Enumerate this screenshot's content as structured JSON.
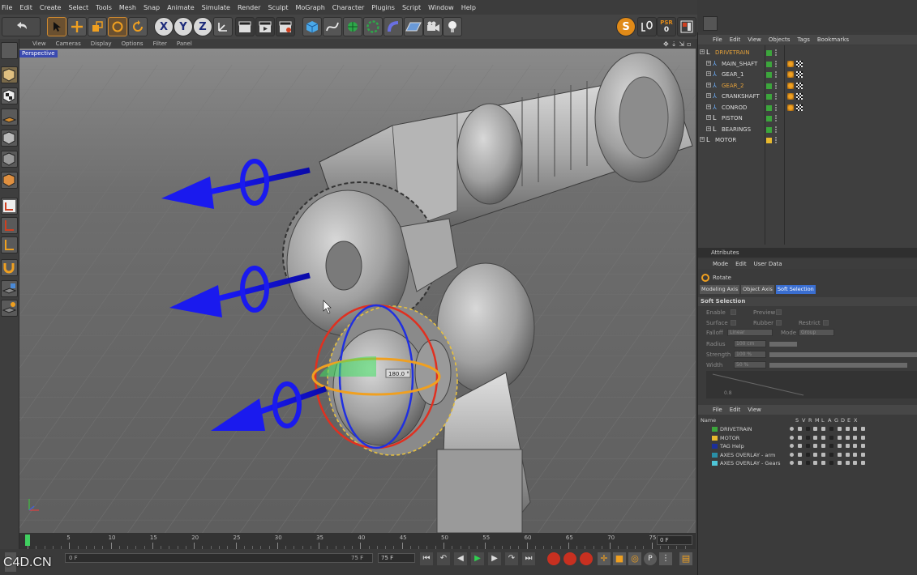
{
  "menubar": [
    "File",
    "Edit",
    "Create",
    "Select",
    "Tools",
    "Mesh",
    "Snap",
    "Animate",
    "Simulate",
    "Render",
    "Sculpt",
    "MoGraph",
    "Character",
    "Plugins",
    "Script",
    "Window",
    "Help"
  ],
  "toolbar": {
    "axis_x": "X",
    "axis_y": "Y",
    "axis_z": "Z",
    "s_label": "S",
    "psr_label": "PSR",
    "psr_value": "0"
  },
  "viewport": {
    "menu": [
      "View",
      "Cameras",
      "Display",
      "Options",
      "Filter",
      "Panel"
    ],
    "label": "Perspective",
    "rotate_readout": "180.0 °"
  },
  "timeline": {
    "ticks": [
      "0",
      "5",
      "10",
      "15",
      "20",
      "25",
      "30",
      "35",
      "40",
      "45",
      "50",
      "55",
      "60",
      "65",
      "70",
      "75"
    ],
    "frame_box": "0 F",
    "start": "0 F",
    "end": "75 F",
    "fps": "75 F"
  },
  "objects_panel": {
    "menu": [
      "File",
      "Edit",
      "View",
      "Objects",
      "Tags",
      "Bookmarks"
    ],
    "rows": [
      {
        "name": "DRIVETRAIN",
        "color": "#e6a23a",
        "icon": "null-icon",
        "indent": 0,
        "layer": "#3ca63c",
        "tags": []
      },
      {
        "name": "MAIN_SHAFT",
        "color": "#dcdcdc",
        "icon": "joint-icon",
        "indent": 1,
        "layer": "#3ca63c",
        "tags": [
          "material",
          "checker"
        ]
      },
      {
        "name": "GEAR_1",
        "color": "#dcdcdc",
        "icon": "joint-icon",
        "indent": 1,
        "layer": "#3ca63c",
        "tags": [
          "material",
          "checker"
        ]
      },
      {
        "name": "GEAR_2",
        "color": "#e6a23a",
        "icon": "joint-icon",
        "indent": 1,
        "layer": "#3ca63c",
        "tags": [
          "material",
          "checker"
        ]
      },
      {
        "name": "CRANKSHAFT",
        "color": "#dcdcdc",
        "icon": "joint-icon",
        "indent": 1,
        "layer": "#3ca63c",
        "tags": [
          "material",
          "checker"
        ]
      },
      {
        "name": "CONROD",
        "color": "#dcdcdc",
        "icon": "joint-icon",
        "indent": 1,
        "layer": "#3ca63c",
        "tags": [
          "material",
          "checker"
        ]
      },
      {
        "name": "PISTON",
        "color": "#dcdcdc",
        "icon": "null-icon",
        "indent": 1,
        "layer": "#3ca63c",
        "tags": []
      },
      {
        "name": "BEARINGS",
        "color": "#dcdcdc",
        "icon": "null-icon",
        "indent": 1,
        "layer": "#3ca63c",
        "tags": []
      },
      {
        "name": "MOTOR",
        "color": "#dcdcdc",
        "icon": "null-icon",
        "indent": 0,
        "layer": "#e8b92e",
        "tags": []
      }
    ]
  },
  "attributes_panel": {
    "title": "Attributes",
    "menu": [
      "Mode",
      "Edit",
      "User Data"
    ],
    "tool": "Rotate",
    "tabs": [
      "Modeling Axis",
      "Object Axis",
      "Soft Selection"
    ],
    "active_tab": "Soft Selection",
    "section": "Soft Selection",
    "fields": {
      "enable": "Enable",
      "preview": "Preview",
      "surface": "Surface",
      "rubber": "Rubber",
      "restrict": "Restrict",
      "falloff": "Falloff",
      "falloff_value": "Linear",
      "mode": "Mode",
      "mode_value": "Group",
      "radius": "Radius",
      "radius_value": "100 cm",
      "strength": "Strength",
      "strength_value": "100 %",
      "width": "Width",
      "width_value": "50 %",
      "graph_value": "0.8"
    }
  },
  "layers_panel": {
    "menu": [
      "File",
      "Edit",
      "View"
    ],
    "columns": [
      "Name",
      "S",
      "V",
      "R",
      "M",
      "L",
      "A",
      "G",
      "D",
      "E",
      "X"
    ],
    "rows": [
      {
        "name": "DRIVETRAIN",
        "color": "#3ca63c"
      },
      {
        "name": "MOTOR",
        "color": "#e8b92e"
      },
      {
        "name": "TAG Help",
        "color": "#1c2f9a"
      },
      {
        "name": "AXES OVERLAY - arm",
        "color": "#2a8fa6"
      },
      {
        "name": "AXES OVERLAY - Gears",
        "color": "#4fc6d8"
      }
    ]
  },
  "watermark": "C4D.CN",
  "logo_side": "CINEMA 4D"
}
